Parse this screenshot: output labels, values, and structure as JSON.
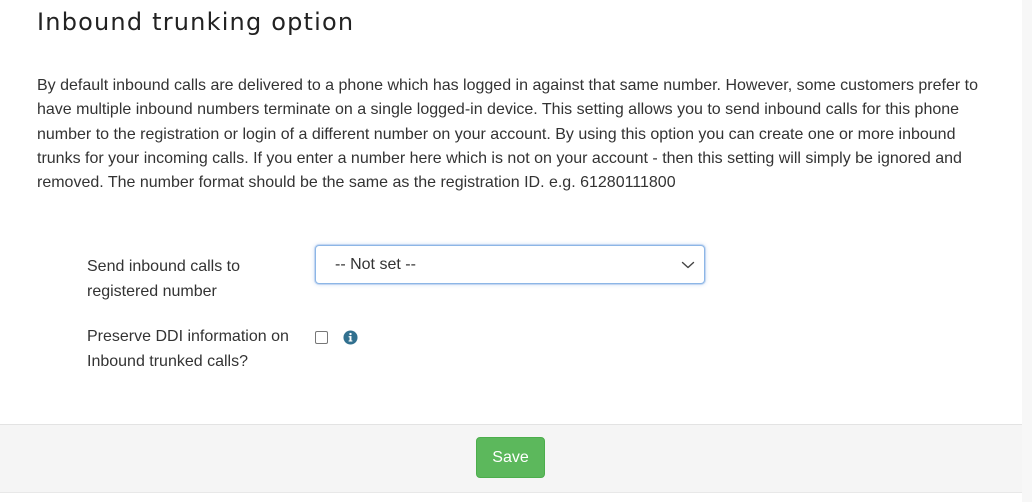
{
  "header": {
    "title": "Inbound trunking option"
  },
  "description": "By default inbound calls are delivered to a phone which has logged in against that same number. However, some customers prefer to have multiple inbound numbers terminate on a single logged-in device. This setting allows you to send inbound calls for this phone number to the registration or login of a different number on your account. By using this option you can create one or more inbound trunks for your incoming calls. If you enter a number here which is not on your account - then this setting will simply be ignored and removed. The number format should be the same as the registration ID. e.g. 61280111800",
  "form": {
    "route_label": "Send inbound calls to registered number",
    "route_selected": "-- Not set --",
    "route_icon": "chevron-down-icon",
    "ddi_label": "Preserve DDI information on Inbound trunked calls?",
    "ddi_checked": false,
    "ddi_info_icon": "info-icon"
  },
  "footer": {
    "save_label": "Save"
  },
  "colors": {
    "save_button": "#5cb85c",
    "info_icon": "#31708f",
    "select_focus_border": "#8cb6e6",
    "footer_background": "#f5f5f5"
  }
}
